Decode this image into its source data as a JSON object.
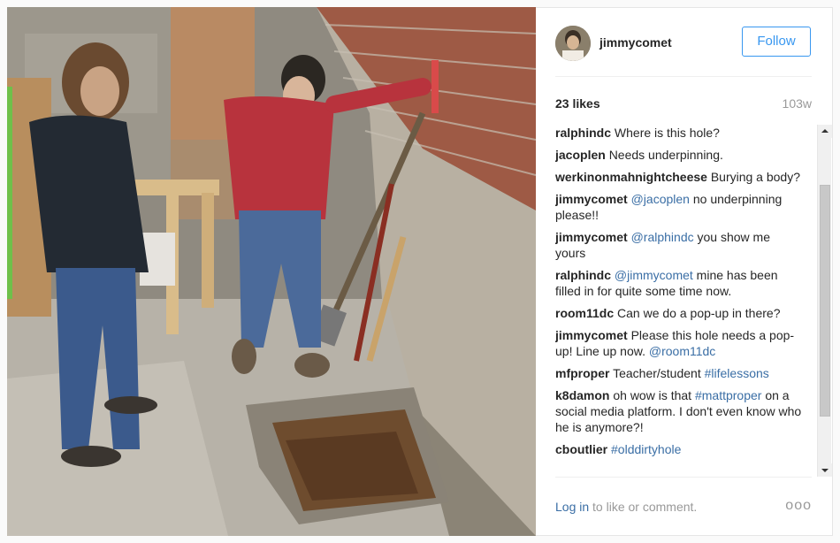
{
  "post": {
    "username": "jimmycomet",
    "follow_label": "Follow",
    "likes": "23 likes",
    "age": "103w"
  },
  "comments": [
    {
      "author": "ralphindc",
      "parts": [
        {
          "t": "Where is this hole?"
        }
      ]
    },
    {
      "author": "jacoplen",
      "parts": [
        {
          "t": "Needs underpinning."
        }
      ]
    },
    {
      "author": "werkinonmahnightcheese",
      "parts": [
        {
          "t": "Burying a body?"
        }
      ]
    },
    {
      "author": "jimmycomet",
      "parts": [
        {
          "t": "@jacoplen",
          "tag": true
        },
        {
          "t": " no underpinning please!!"
        }
      ]
    },
    {
      "author": "jimmycomet",
      "parts": [
        {
          "t": "@ralphindc",
          "tag": true
        },
        {
          "t": " you show me yours"
        }
      ]
    },
    {
      "author": "ralphindc",
      "parts": [
        {
          "t": "@jimmycomet",
          "tag": true
        },
        {
          "t": " mine has been filled in for quite some time now."
        }
      ]
    },
    {
      "author": "room11dc",
      "parts": [
        {
          "t": "Can we do a pop-up in there?"
        }
      ]
    },
    {
      "author": "jimmycomet",
      "parts": [
        {
          "t": "Please this hole needs a pop-up! Line up now. "
        },
        {
          "t": "@room11dc",
          "tag": true
        }
      ]
    },
    {
      "author": "mfproper",
      "parts": [
        {
          "t": "Teacher/student "
        },
        {
          "t": "#lifelessons",
          "tag": true
        }
      ]
    },
    {
      "author": "k8damon",
      "parts": [
        {
          "t": "oh wow is that "
        },
        {
          "t": "#mattproper",
          "tag": true
        },
        {
          "t": " on a social media platform. I don't even know who he is anymore?!"
        }
      ]
    },
    {
      "author": "cboutlier",
      "parts": [
        {
          "t": "#olddirtyhole",
          "tag": true
        }
      ]
    }
  ],
  "footer": {
    "login": "Log in",
    "rest": " to like or comment.",
    "more": "ooo"
  },
  "icons": {
    "more": "more-options-icon",
    "scroll_up": "scroll-up-arrow-icon",
    "scroll_down": "scroll-down-arrow-icon"
  },
  "colors": {
    "follow_blue": "#3897f0",
    "link_blue": "#3a6ea5",
    "muted": "#999999"
  }
}
